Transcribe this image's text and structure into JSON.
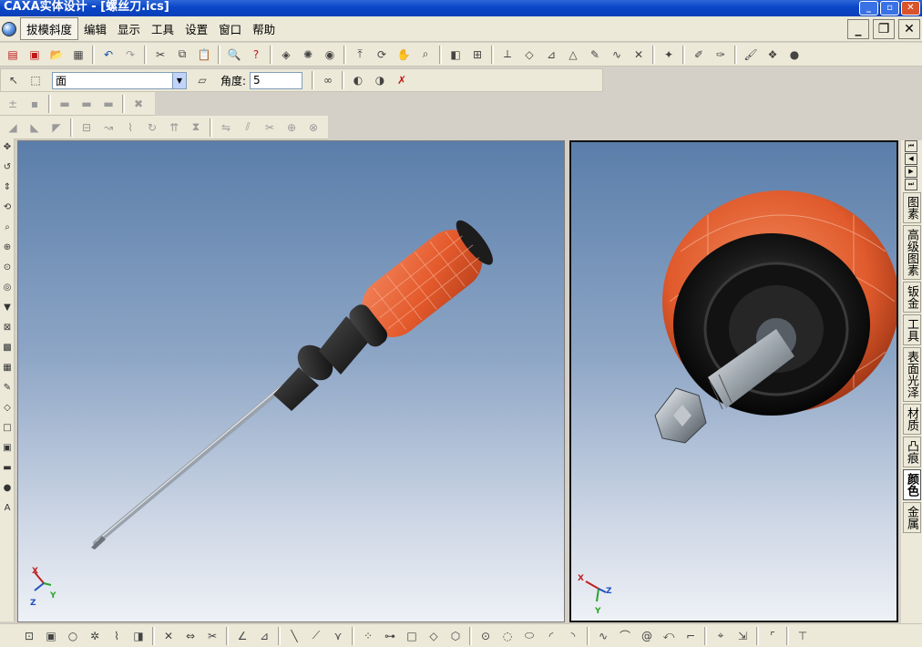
{
  "window": {
    "title": "CAXA实体设计 - [螺丝刀.ics]"
  },
  "menu": {
    "items": [
      "拔模斜度",
      "编辑",
      "显示",
      "工具",
      "设置",
      "窗口",
      "帮助"
    ],
    "active_index": 0
  },
  "toolbar_props": {
    "face_combo_value": "面",
    "angle_label": "角度:",
    "angle_value": "5"
  },
  "viewports": {
    "left": {
      "axes": {
        "x": "X",
        "y": "Y",
        "z": "Z"
      }
    },
    "right": {
      "axes": {
        "x": "X",
        "y": "Y",
        "z": "Z"
      }
    }
  },
  "design_tabs": {
    "items": [
      "图素",
      "高级图素",
      "钣金",
      "工具",
      "表面光泽",
      "材质",
      "凸痕",
      "颜色",
      "金属"
    ],
    "active_index": 7
  },
  "colors": {
    "handle_orange": "#e8663a",
    "handle_black": "#1a1a1a",
    "titlebar_blue": "#0a46c8"
  }
}
